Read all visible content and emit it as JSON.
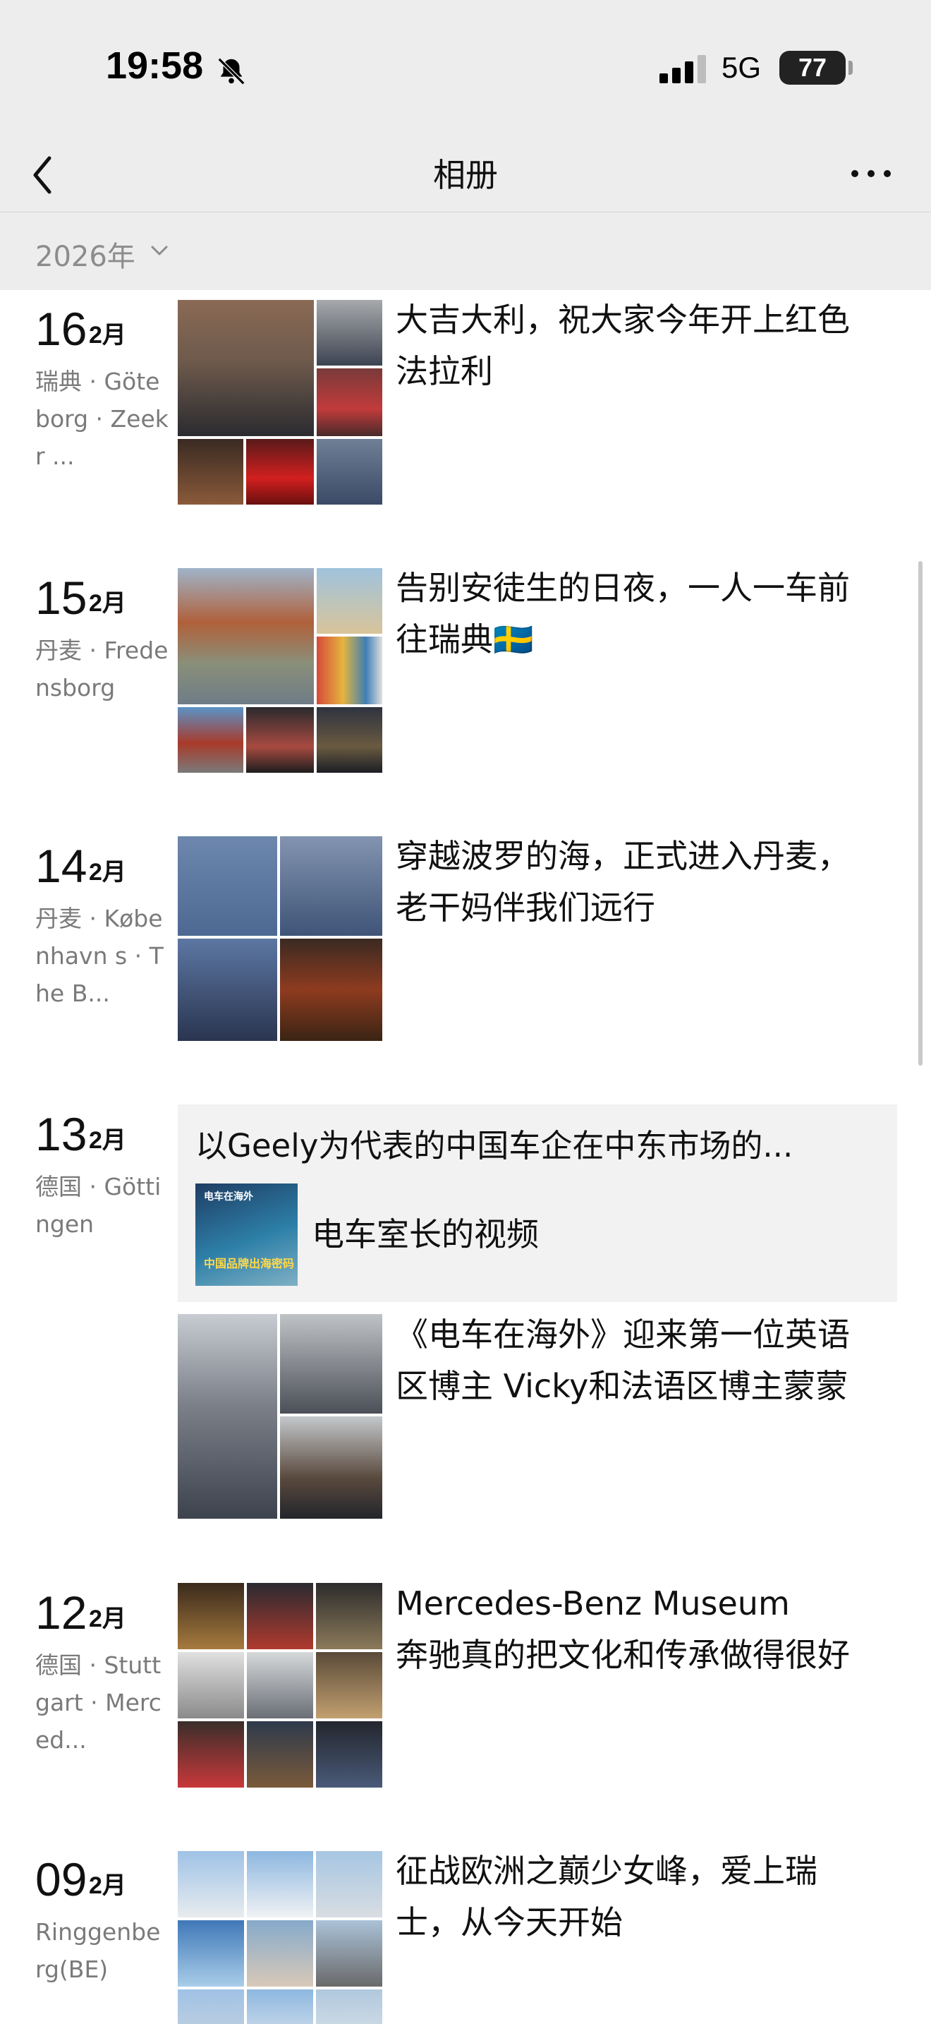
{
  "status_bar": {
    "time": "19:58",
    "network": "5G",
    "battery": "77"
  },
  "nav": {
    "title": "相册"
  },
  "year_filter": {
    "label": "2026年"
  },
  "posts": [
    {
      "day": "16",
      "month": "2月",
      "location": "瑞典 · Göteborg · Zeekr ...",
      "caption": "大吉大利，祝大家今年开上红色法拉利"
    },
    {
      "day": "15",
      "month": "2月",
      "location": "丹麦 · Fredensborg",
      "caption": "告别安徒生的日夜，一人一车前往瑞典🇸🇪"
    },
    {
      "day": "14",
      "month": "2月",
      "location": "丹麦 · København s · The B...",
      "caption": "穿越波罗的海，正式进入丹麦，老干妈伴我们远行"
    },
    {
      "day": "13",
      "month": "2月",
      "location": "德国 · Göttingen",
      "caption": "《电车在海外》迎来第一位英语区博主 Vicky和法语区博主蒙蒙"
    },
    {
      "day": "12",
      "month": "2月",
      "location": "德国 · Stuttgart · Merced...",
      "caption": "Mercedes-Benz Museum\n奔驰真的把文化和传承做得很好"
    },
    {
      "day": "09",
      "month": "2月",
      "location": "Ringgenberg(BE)",
      "caption": "征战欧洲之巅少女峰，爱上瑞士，从今天开始"
    }
  ],
  "shared_video": {
    "title": "以Geely为代表的中国车企在中东市场的...",
    "thumb_top_text": "电车在海外",
    "thumb_bottom_text": "中国品牌出海密码",
    "label": "电车室长的视频"
  }
}
